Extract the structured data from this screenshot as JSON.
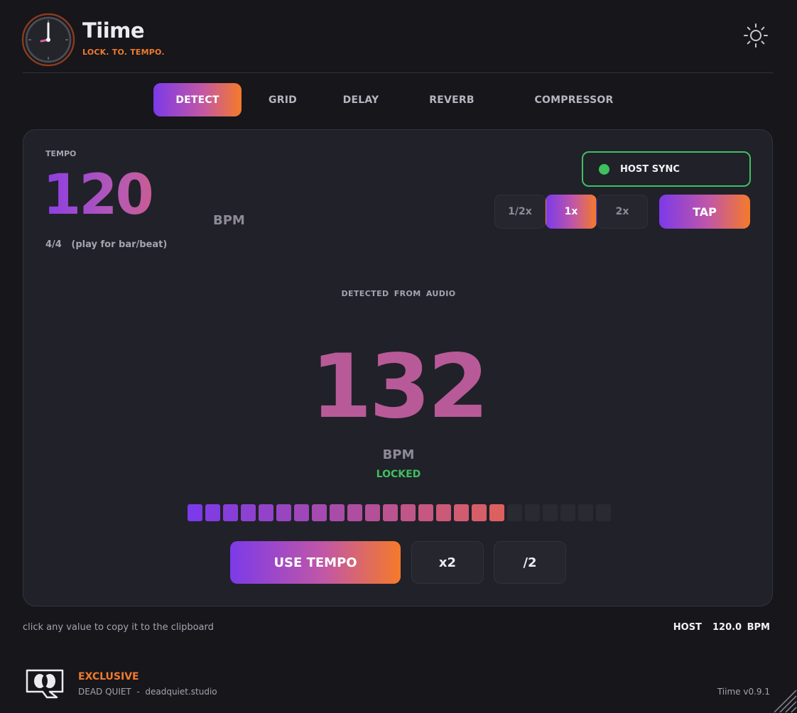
{
  "header": {
    "title": "Tiime",
    "tagline": "LOCK. TO. TEMPO.",
    "logo_icon": "clock-icon",
    "settings_icon": "sun-icon"
  },
  "tabs": [
    {
      "label": "DETECT",
      "active": true
    },
    {
      "label": "GRID",
      "active": false
    },
    {
      "label": "DELAY",
      "active": false
    },
    {
      "label": "REVERB",
      "active": false
    },
    {
      "label": "COMPRESSOR",
      "active": false
    }
  ],
  "tempo": {
    "label": "TEMPO",
    "value": "120",
    "unit": "BPM",
    "signature": "4/4   (play for bar/beat)"
  },
  "host_sync": {
    "label": "HOST SYNC",
    "status_color": "#3fbf5e"
  },
  "multipliers": [
    {
      "label": "1/2x",
      "active": false
    },
    {
      "label": "1x",
      "active": true
    },
    {
      "label": "2x",
      "active": false
    }
  ],
  "tap_label": "TAP",
  "detected": {
    "label": "DETECTED FROM AUDIO",
    "value": "132",
    "unit": "BPM",
    "status": "LOCKED"
  },
  "confidence_meter": {
    "total_segments": 24,
    "filled_segments": 18,
    "start_color": "#7c3ae8",
    "end_color": "#dc6060",
    "empty_color": "#2a2a33"
  },
  "actions": {
    "use_tempo": "USE TEMPO",
    "double": "x2",
    "half": "/2"
  },
  "footer": {
    "hint": "click any value to copy it to the clipboard",
    "host_readout": "HOST  120.0 BPM",
    "badge": "EXCLUSIVE",
    "brand_line": "DEAD QUIET  -  deadquiet.studio",
    "version": "Tiime v0.9.1"
  },
  "colors": {
    "accent_orange": "#f07a2c",
    "accent_purple": "#7c3ae8",
    "ok_green": "#3fbf5e"
  }
}
